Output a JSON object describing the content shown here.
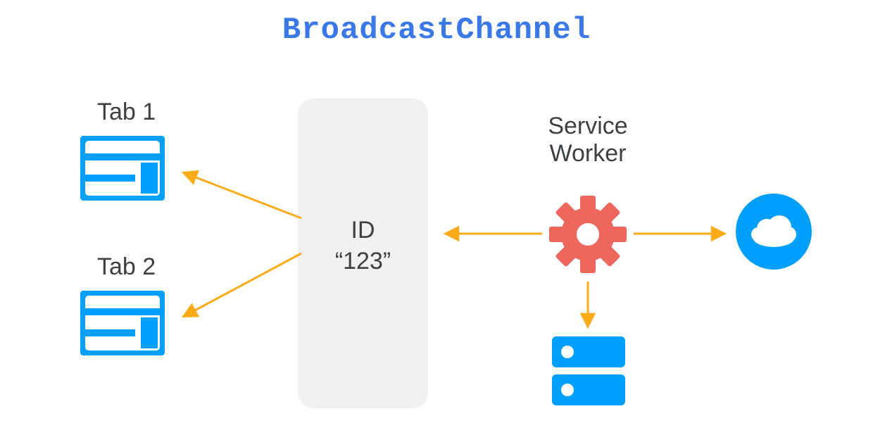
{
  "title": "BroadcastChannel",
  "tabs": {
    "0": {
      "label": "Tab 1"
    },
    "1": {
      "label": "Tab 2"
    }
  },
  "channel": {
    "id_label": "ID",
    "id_value": "“123”"
  },
  "service_worker": {
    "label_line1": "Service",
    "label_line2": "Worker"
  },
  "colors": {
    "title": "#3b78e7",
    "accent_blue": "#009FFC",
    "accent_red": "#EE675C",
    "arrow": "#FAAB17",
    "neutral_bg": "#f1f1f1",
    "text": "#3d4043"
  },
  "nodes": {
    "tab1": "browser-tab",
    "tab2": "browser-tab",
    "channel": "broadcast-channel",
    "service_worker": "service-worker-gear",
    "cloud": "cloud-network",
    "storage": "local-storage"
  },
  "arrows": [
    {
      "from": "channel",
      "to": "tab1"
    },
    {
      "from": "channel",
      "to": "tab2"
    },
    {
      "from": "service_worker",
      "to": "channel"
    },
    {
      "from": "service_worker",
      "to": "cloud"
    },
    {
      "from": "service_worker",
      "to": "storage"
    }
  ]
}
